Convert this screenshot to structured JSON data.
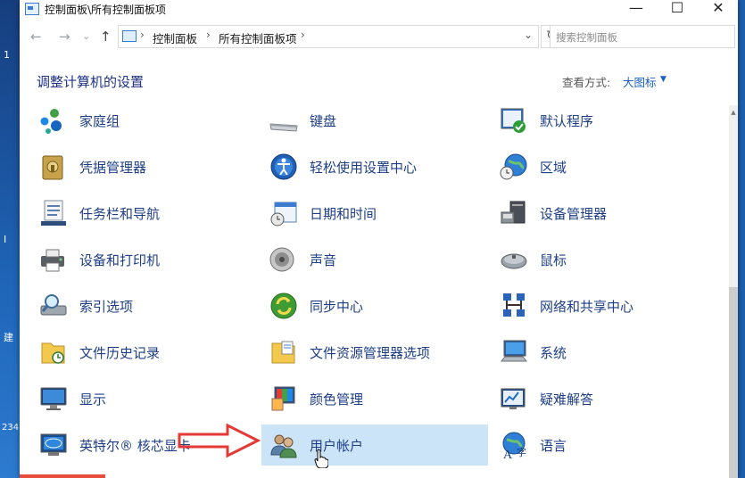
{
  "window": {
    "title": "控制面板\\所有控制面板项",
    "minimize": "—",
    "maximize": "☐",
    "close": "✕"
  },
  "address": {
    "back": "←",
    "forward": "→",
    "recent": "⌄",
    "up": "↑",
    "crumbs": [
      "控制面板",
      "所有控制面板项"
    ],
    "separator": "›",
    "dropdown": "⌄",
    "refresh": "↻",
    "search_placeholder": "搜索控制面板"
  },
  "header": {
    "title": "调整计算机的设置",
    "view_by_label": "查看方式:",
    "view_by_value": "大图标",
    "view_by_arrow": "▼"
  },
  "scroll_up": "▲",
  "desktop": {
    "left_labels": [
      "1",
      "I",
      "建",
      "234"
    ]
  },
  "items": [
    [
      {
        "label": "家庭组",
        "icon": "homegroup-icon"
      },
      {
        "label": "凭据管理器",
        "icon": "credential-manager-icon"
      },
      {
        "label": "任务栏和导航",
        "icon": "taskbar-icon"
      },
      {
        "label": "设备和打印机",
        "icon": "printer-icon"
      },
      {
        "label": "索引选项",
        "icon": "indexing-icon"
      },
      {
        "label": "文件历史记录",
        "icon": "file-history-icon"
      },
      {
        "label": "显示",
        "icon": "display-icon"
      },
      {
        "label": "英特尔® 核芯显卡",
        "icon": "intel-graphics-icon"
      }
    ],
    [
      {
        "label": "键盘",
        "icon": "keyboard-icon"
      },
      {
        "label": "轻松使用设置中心",
        "icon": "ease-of-access-icon"
      },
      {
        "label": "日期和时间",
        "icon": "calendar-clock-icon"
      },
      {
        "label": "声音",
        "icon": "speaker-icon"
      },
      {
        "label": "同步中心",
        "icon": "sync-center-icon"
      },
      {
        "label": "文件资源管理器选项",
        "icon": "folder-options-icon"
      },
      {
        "label": "颜色管理",
        "icon": "color-management-icon"
      },
      {
        "label": "用户帐户",
        "icon": "user-accounts-icon"
      }
    ],
    [
      {
        "label": "默认程序",
        "icon": "default-programs-icon"
      },
      {
        "label": "区域",
        "icon": "region-globe-icon"
      },
      {
        "label": "设备管理器",
        "icon": "device-manager-icon"
      },
      {
        "label": "鼠标",
        "icon": "mouse-icon"
      },
      {
        "label": "网络和共享中心",
        "icon": "network-sharing-icon"
      },
      {
        "label": "系统",
        "icon": "system-icon"
      },
      {
        "label": "疑难解答",
        "icon": "troubleshooting-icon"
      },
      {
        "label": "语言",
        "icon": "language-icon"
      }
    ]
  ],
  "colors": {
    "link": "#1e3e86",
    "heading": "#1e3287",
    "highlight": "#cce4f7",
    "arrow": "#e53935"
  }
}
